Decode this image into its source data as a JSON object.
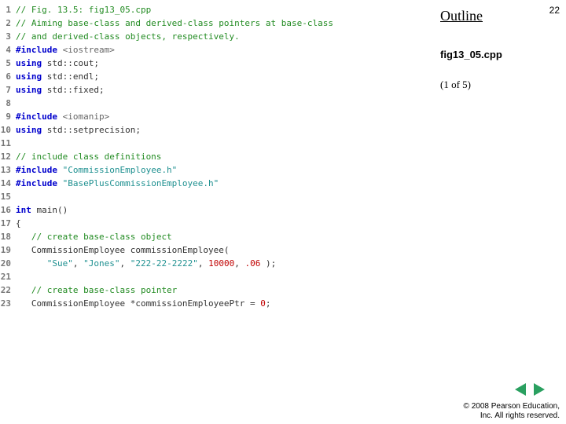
{
  "header": {
    "outline_label": "Outline",
    "page_number": "22",
    "filename": "fig13_05.cpp",
    "part_label": "(1 of 5)"
  },
  "footer": {
    "copyright_line1": "© 2008 Pearson Education,",
    "copyright_line2": "Inc.  All rights reserved."
  },
  "code": {
    "lines": [
      {
        "n": "1",
        "tokens": [
          {
            "t": "// Fig. 13.5: fig13_05.cpp",
            "c": "c-comment"
          }
        ]
      },
      {
        "n": "2",
        "tokens": [
          {
            "t": "// Aiming base-class and derived-class pointers at base-class",
            "c": "c-comment"
          }
        ]
      },
      {
        "n": "3",
        "tokens": [
          {
            "t": "// and derived-class objects, respectively.",
            "c": "c-comment"
          }
        ]
      },
      {
        "n": "4",
        "tokens": [
          {
            "t": "#include ",
            "c": "c-pp"
          },
          {
            "t": "<iostream>",
            "c": "c-hdr"
          }
        ]
      },
      {
        "n": "5",
        "tokens": [
          {
            "t": "using ",
            "c": "c-kw"
          },
          {
            "t": "std::cout;",
            "c": "c-id"
          }
        ]
      },
      {
        "n": "6",
        "tokens": [
          {
            "t": "using ",
            "c": "c-kw"
          },
          {
            "t": "std::endl;",
            "c": "c-id"
          }
        ]
      },
      {
        "n": "7",
        "tokens": [
          {
            "t": "using ",
            "c": "c-kw"
          },
          {
            "t": "std::fixed;",
            "c": "c-id"
          }
        ]
      },
      {
        "n": "8",
        "tokens": []
      },
      {
        "n": "9",
        "tokens": [
          {
            "t": "#include ",
            "c": "c-pp"
          },
          {
            "t": "<iomanip>",
            "c": "c-hdr"
          }
        ]
      },
      {
        "n": "10",
        "tokens": [
          {
            "t": "using ",
            "c": "c-kw"
          },
          {
            "t": "std::setprecision;",
            "c": "c-id"
          }
        ]
      },
      {
        "n": "11",
        "tokens": []
      },
      {
        "n": "12",
        "tokens": [
          {
            "t": "// include class definitions",
            "c": "c-comment"
          }
        ]
      },
      {
        "n": "13",
        "tokens": [
          {
            "t": "#include ",
            "c": "c-pp"
          },
          {
            "t": "\"CommissionEmployee.h\"",
            "c": "c-str"
          }
        ]
      },
      {
        "n": "14",
        "tokens": [
          {
            "t": "#include ",
            "c": "c-pp"
          },
          {
            "t": "\"BasePlusCommissionEmployee.h\"",
            "c": "c-str"
          }
        ]
      },
      {
        "n": "15",
        "tokens": []
      },
      {
        "n": "16",
        "tokens": [
          {
            "t": "int ",
            "c": "c-kw"
          },
          {
            "t": "main()",
            "c": "c-id"
          }
        ]
      },
      {
        "n": "17",
        "tokens": [
          {
            "t": "{",
            "c": "c-op"
          }
        ]
      },
      {
        "n": "18",
        "tokens": [
          {
            "t": "   ",
            "c": "c-id"
          },
          {
            "t": "// create base-class object",
            "c": "c-comment"
          }
        ]
      },
      {
        "n": "19",
        "tokens": [
          {
            "t": "   CommissionEmployee commissionEmployee(",
            "c": "c-id"
          }
        ]
      },
      {
        "n": "20",
        "tokens": [
          {
            "t": "      ",
            "c": "c-id"
          },
          {
            "t": "\"Sue\"",
            "c": "c-str"
          },
          {
            "t": ", ",
            "c": "c-op"
          },
          {
            "t": "\"Jones\"",
            "c": "c-str"
          },
          {
            "t": ", ",
            "c": "c-op"
          },
          {
            "t": "\"222-22-2222\"",
            "c": "c-str"
          },
          {
            "t": ", ",
            "c": "c-op"
          },
          {
            "t": "10000",
            "c": "c-num"
          },
          {
            "t": ", ",
            "c": "c-op"
          },
          {
            "t": ".06",
            "c": "c-num"
          },
          {
            "t": " );",
            "c": "c-op"
          }
        ]
      },
      {
        "n": "21",
        "tokens": []
      },
      {
        "n": "22",
        "tokens": [
          {
            "t": "   ",
            "c": "c-id"
          },
          {
            "t": "// create base-class pointer",
            "c": "c-comment"
          }
        ]
      },
      {
        "n": "23",
        "tokens": [
          {
            "t": "   CommissionEmployee *commissionEmployeePtr = ",
            "c": "c-id"
          },
          {
            "t": "0",
            "c": "c-num"
          },
          {
            "t": ";",
            "c": "c-op"
          }
        ]
      }
    ]
  }
}
